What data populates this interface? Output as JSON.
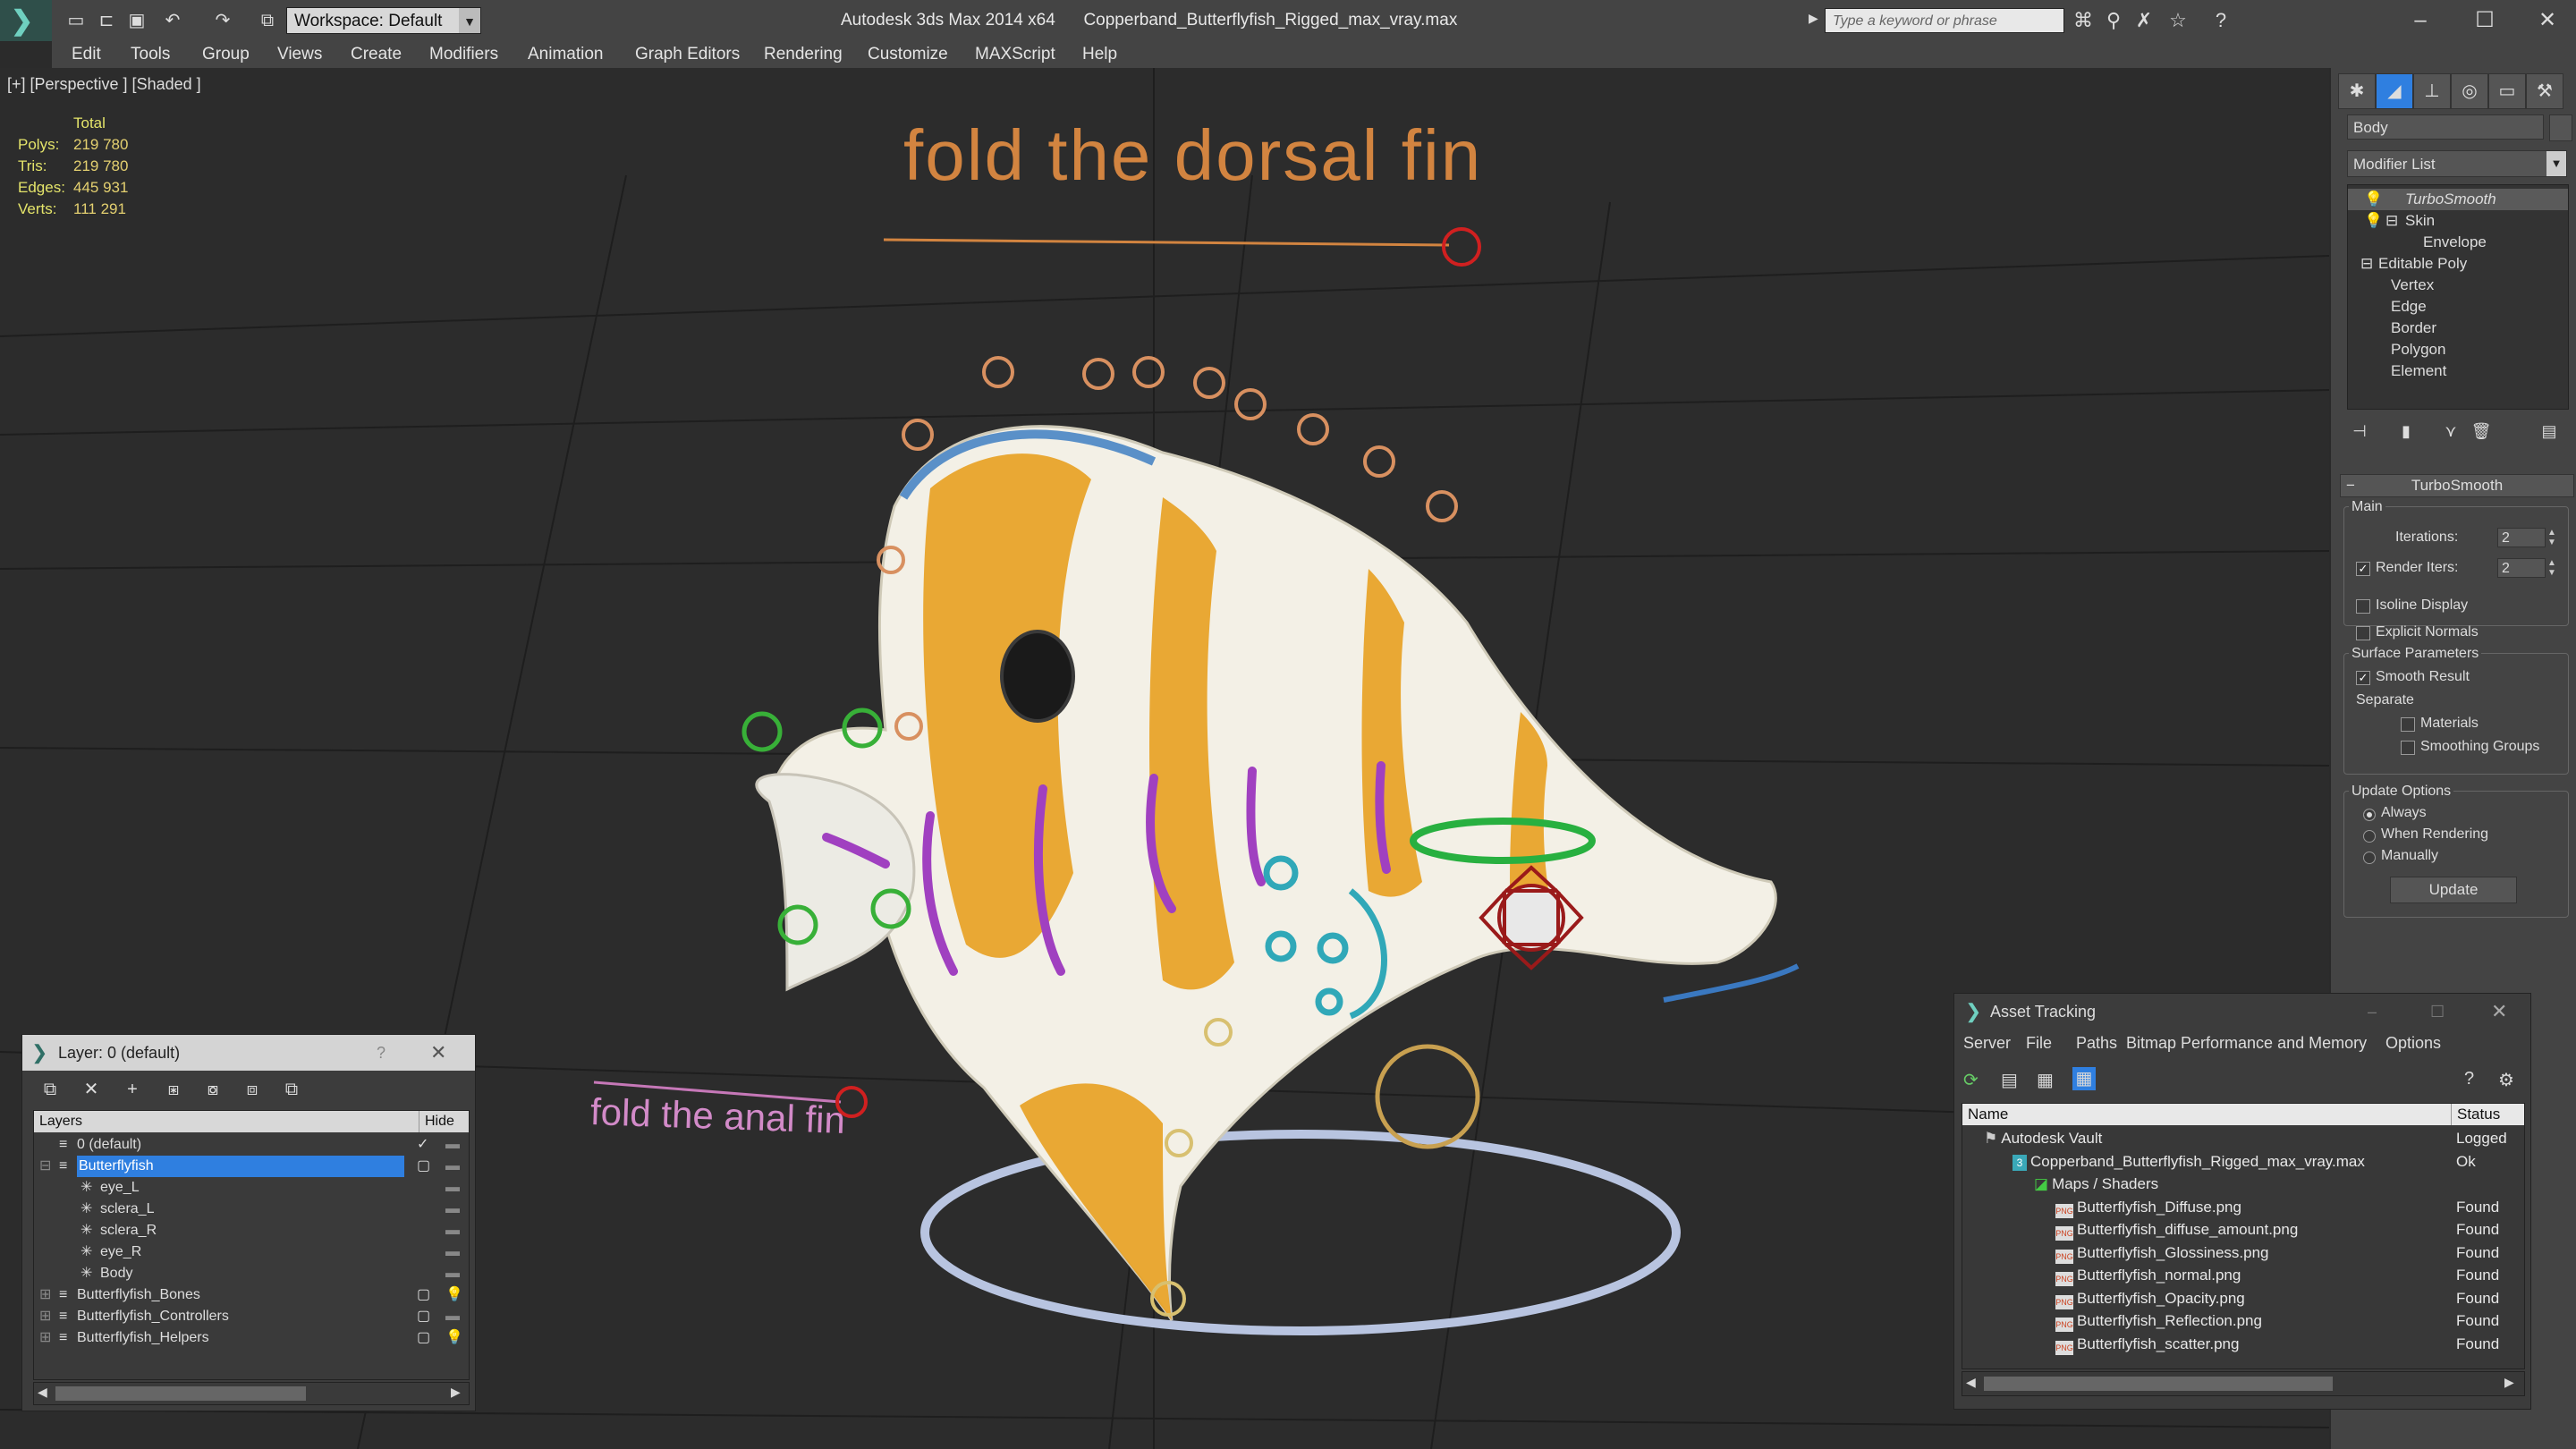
{
  "titlebar": {
    "app_title": "Autodesk 3ds Max 2014 x64",
    "file_title": "Copperband_Butterflyfish_Rigged_max_vray.max",
    "workspace": "Workspace: Default",
    "search_placeholder": "Type a keyword or phrase"
  },
  "menu": [
    "Edit",
    "Tools",
    "Group",
    "Views",
    "Create",
    "Modifiers",
    "Animation",
    "Graph Editors",
    "Rendering",
    "Customize",
    "MAXScript",
    "Help"
  ],
  "viewport": {
    "label": "[+] [Perspective ] [Shaded ]",
    "stats_header": "Total",
    "stats": [
      {
        "label": "Polys:",
        "value": "219 780"
      },
      {
        "label": "Tris:",
        "value": "219 780"
      },
      {
        "label": "Edges:",
        "value": "445 931"
      },
      {
        "label": "Verts:",
        "value": "111 291"
      }
    ],
    "annotation_dorsal": "fold the dorsal fin",
    "annotation_anal": "fold the anal fin"
  },
  "command_panel": {
    "object_name": "Body",
    "modifier_list": "Modifier List",
    "stack": [
      {
        "label": "TurboSmooth",
        "indent": 0,
        "selected": true
      },
      {
        "label": "Skin",
        "indent": 0,
        "selected": false
      },
      {
        "label": "Envelope",
        "indent": 2,
        "selected": false
      },
      {
        "label": "Editable Poly",
        "indent": 0,
        "selected": false
      },
      {
        "label": "Vertex",
        "indent": 1,
        "selected": false
      },
      {
        "label": "Edge",
        "indent": 1,
        "selected": false
      },
      {
        "label": "Border",
        "indent": 1,
        "selected": false
      },
      {
        "label": "Polygon",
        "indent": 1,
        "selected": false
      },
      {
        "label": "Element",
        "indent": 1,
        "selected": false
      }
    ],
    "rollout_title": "TurboSmooth",
    "main_group": "Main",
    "iterations_label": "Iterations:",
    "iterations_value": "2",
    "render_iters_label": "Render Iters:",
    "render_iters_value": "2",
    "isoline_label": "Isoline Display",
    "explicit_normals_label": "Explicit Normals",
    "surface_group": "Surface Parameters",
    "smooth_result_label": "Smooth Result",
    "separate_label": "Separate",
    "materials_label": "Materials",
    "smoothing_groups_label": "Smoothing Groups",
    "update_group": "Update Options",
    "always_label": "Always",
    "when_rendering_label": "When Rendering",
    "manually_label": "Manually",
    "update_button": "Update"
  },
  "layer_panel": {
    "title": "Layer: 0 (default)",
    "col_layers": "Layers",
    "col_hide": "Hide",
    "rows": [
      {
        "name": "0 (default)",
        "indent": 1,
        "hide": "check",
        "selected": false
      },
      {
        "name": "Butterflyfish",
        "indent": 1,
        "hide": "box",
        "selected": true
      },
      {
        "name": "eye_L",
        "indent": 2,
        "hide": "dash",
        "selected": false
      },
      {
        "name": "sclera_L",
        "indent": 2,
        "hide": "dash",
        "selected": false
      },
      {
        "name": "sclera_R",
        "indent": 2,
        "hide": "dash",
        "selected": false
      },
      {
        "name": "eye_R",
        "indent": 2,
        "hide": "dash",
        "selected": false
      },
      {
        "name": "Body",
        "indent": 2,
        "hide": "dash",
        "selected": false
      },
      {
        "name": "Butterflyfish_Bones",
        "indent": 1,
        "hide": "box",
        "selected": false
      },
      {
        "name": "Butterflyfish_Controllers",
        "indent": 1,
        "hide": "box",
        "selected": false
      },
      {
        "name": "Butterflyfish_Helpers",
        "indent": 1,
        "hide": "box",
        "selected": false
      }
    ]
  },
  "asset_panel": {
    "title": "Asset Tracking",
    "menu": [
      "Server",
      "File",
      "Paths",
      "Bitmap Performance and Memory",
      "Options"
    ],
    "col_name": "Name",
    "col_status": "Status",
    "rows": [
      {
        "name": "Autodesk Vault",
        "indent": 1,
        "status": "Logged",
        "icon": "vault"
      },
      {
        "name": "Copperband_Butterflyfish_Rigged_max_vray.max",
        "indent": 2,
        "status": "Ok",
        "icon": "max"
      },
      {
        "name": "Maps / Shaders",
        "indent": 3,
        "status": "",
        "icon": "maps"
      },
      {
        "name": "Butterflyfish_Diffuse.png",
        "indent": 4,
        "status": "Found",
        "icon": "png"
      },
      {
        "name": "Butterflyfish_diffuse_amount.png",
        "indent": 4,
        "status": "Found",
        "icon": "png"
      },
      {
        "name": "Butterflyfish_Glossiness.png",
        "indent": 4,
        "status": "Found",
        "icon": "png"
      },
      {
        "name": "Butterflyfish_normal.png",
        "indent": 4,
        "status": "Found",
        "icon": "png"
      },
      {
        "name": "Butterflyfish_Opacity.png",
        "indent": 4,
        "status": "Found",
        "icon": "png"
      },
      {
        "name": "Butterflyfish_Reflection.png",
        "indent": 4,
        "status": "Found",
        "icon": "png"
      },
      {
        "name": "Butterflyfish_scatter.png",
        "indent": 4,
        "status": "Found",
        "icon": "png"
      }
    ]
  },
  "colors": {
    "accent_teal": "#6fd0c0",
    "selection_blue": "#2f7fe0",
    "stats_yellow": "#e4d070",
    "annotation_orange": "#d28440",
    "annotation_pink": "#d28ac8"
  }
}
